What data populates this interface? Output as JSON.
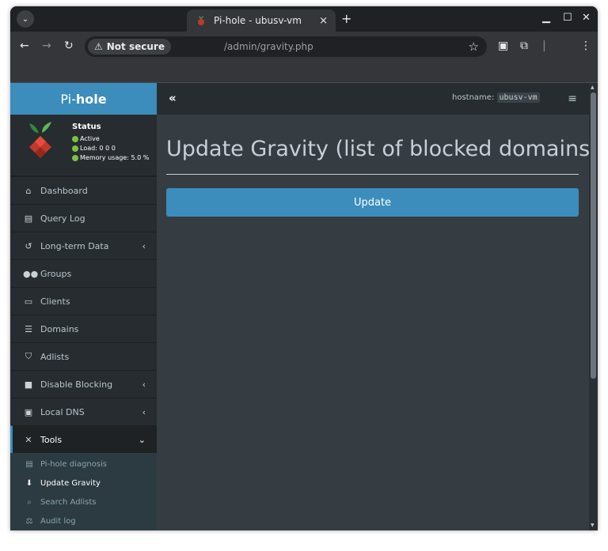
{
  "browser": {
    "tab_title": "Pi-hole - ubusv-vm",
    "tab_close": "×",
    "new_tab": "+",
    "security_chip": "Not secure",
    "url": "/admin/gravity.php"
  },
  "brand": {
    "prefix": "Pi-",
    "suffix": "hole"
  },
  "status": {
    "title": "Status",
    "active": "Active",
    "load": "Load:  0  0  0",
    "memory": "Memory usage:  5.0 %"
  },
  "header": {
    "hostname_label": "hostname:",
    "hostname_value": "ubusv-vm"
  },
  "sidebar": {
    "items": [
      {
        "label": "Dashboard",
        "icon": "home-icon"
      },
      {
        "label": "Query Log",
        "icon": "file-icon"
      },
      {
        "label": "Long-term Data",
        "icon": "history-icon"
      },
      {
        "label": "Groups",
        "icon": "users-icon"
      },
      {
        "label": "Clients",
        "icon": "laptop-icon"
      },
      {
        "label": "Domains",
        "icon": "list-icon"
      },
      {
        "label": "Adlists",
        "icon": "shield-icon"
      },
      {
        "label": "Disable Blocking",
        "icon": "stop-icon"
      },
      {
        "label": "Local DNS",
        "icon": "address-book-icon"
      },
      {
        "label": "Tools",
        "icon": "tools-icon"
      }
    ],
    "tools_sub": [
      {
        "label": "Pi-hole diagnosis",
        "icon": "file-medical-icon"
      },
      {
        "label": "Update Gravity",
        "icon": "arrow-circle-down-icon"
      },
      {
        "label": "Search Adlists",
        "icon": "search-icon"
      },
      {
        "label": "Audit log",
        "icon": "balance-scale-icon"
      }
    ]
  },
  "main": {
    "title": "Update Gravity (list of blocked domains)",
    "update_button": "Update"
  },
  "colors": {
    "accent": "#3c8dbc",
    "sidebar_bg": "#272c30",
    "content_bg": "#353c42",
    "status_green": "#7fc040"
  }
}
